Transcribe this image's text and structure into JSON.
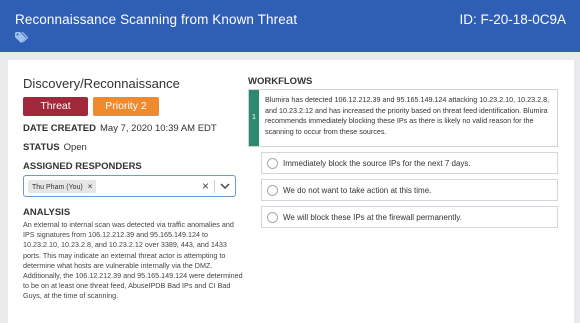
{
  "header": {
    "title": "Reconnaissance Scanning from Known Threat",
    "id_label": "ID: F-20-18-0C9A",
    "bg_color": "#2f5fb4"
  },
  "discovery": {
    "section_title": "Discovery/Reconnaissance",
    "badges": {
      "threat": "Threat",
      "priority": "Priority 2"
    },
    "date_created_label": "DATE CREATED",
    "date_created_value": "May 7, 2020 10:39 AM EDT",
    "status_label": "STATUS",
    "status_value": "Open",
    "assigned_label": "ASSIGNED RESPONDERS",
    "responder_chip": "Thu Pham (You)",
    "analysis_label": "ANALYSIS",
    "analysis_text": "An external to internal scan was detected via traffic anomalies and IPS signatures from 106.12.212.39 and 95.165.149.124 to 10.23.2.10, 10.23.2.8, and 10.23.2.12 over 3389, 443, and 1433 ports. This may indicate an external threat actor is attempting to determine what hosts are vulnerable internally via the DMZ. Additionally, the 106.12.212.39 and 95.165.149.124 were determined to be on at least one threat feed, AbuseIPDB Bad IPs and CI Bad Guys, at the time of scanning."
  },
  "workflows": {
    "title": "WORKFLOWS",
    "step_number": "1",
    "step_text": "Blumira has detected 106.12.212.39 and 95.165.149.124 attacking 10.23.2.10, 10.23.2.8, and 10.23.2.12 and has increased the priority based on threat feed identification. Blumira recommends immediately blocking these IPs as there is likely no valid reason for the scanning to occur from these sources.",
    "options": [
      "Immediately block the source IPs for the next 7 days.",
      "We do not want to take action at this time.",
      "We will block these IPs at the firewall permanently."
    ]
  },
  "icons": {
    "tag": "tags-icon",
    "clear": "clear-icon",
    "chevron": "chevron-down-icon",
    "chip_remove": "close-icon"
  }
}
